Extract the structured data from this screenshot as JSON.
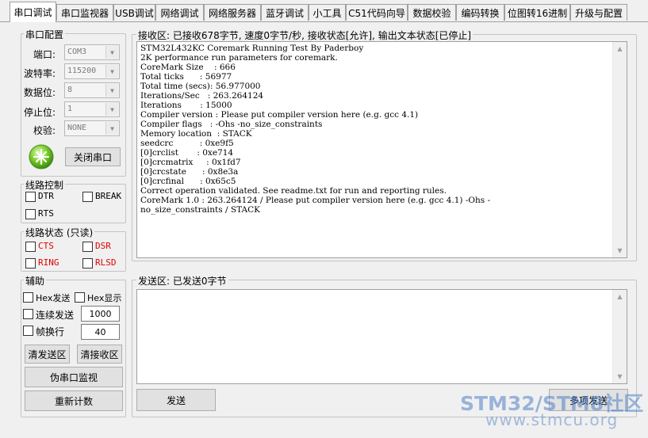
{
  "tabs": [
    "串口调试",
    "串口监视器",
    "USB调试",
    "网络调试",
    "网络服务器",
    "蓝牙调试",
    "小工具",
    "C51代码向导",
    "数据校验",
    "编码转换",
    "位图转16进制",
    "升级与配置"
  ],
  "serial_config": {
    "title": "串口配置",
    "port_label": "端口:",
    "port_value": "COM3",
    "baud_label": "波特率:",
    "baud_value": "115200",
    "databits_label": "数据位:",
    "databits_value": "8",
    "stopbits_label": "停止位:",
    "stopbits_value": "1",
    "parity_label": "校验:",
    "parity_value": "NONE",
    "close_button": "关闭串口"
  },
  "line_control": {
    "title": "线路控制",
    "dtr": "DTR",
    "break": "BREAK",
    "rts": "RTS"
  },
  "line_status": {
    "title": "线路状态 (只读)",
    "cts": "CTS",
    "dsr": "DSR",
    "ring": "RING",
    "rlsd": "RLSD"
  },
  "assist": {
    "title": "辅助",
    "hex_send": "Hex发送",
    "hex_show": "Hex显示",
    "continuous_send": "连续发送",
    "continuous_value": "1000",
    "frame_newline": "帧换行",
    "frame_value": "40",
    "clear_send": "清发送区",
    "clear_recv": "清接收区",
    "pseudo_monitor": "伪串口监视",
    "recount": "重新计数"
  },
  "receive": {
    "title": "接收区: 已接收678字节, 速度0字节/秒, 接收状态[允许], 输出文本状态[已停止]",
    "lines": [
      "STM32L432KC Coremark Running Test By Paderboy",
      "2K performance run parameters for coremark.",
      "CoreMark Size    : 666",
      "Total ticks      : 56977",
      "Total time (secs): 56.977000",
      "Iterations/Sec   : 263.264124",
      "Iterations       : 15000",
      "Compiler version : Please put compiler version here (e.g. gcc 4.1)",
      "Compiler flags   : -Ohs -no_size_constraints",
      "Memory location  : STACK",
      "seedcrc          : 0xe9f5",
      "[0]crclist       : 0xe714",
      "[0]crcmatrix     : 0x1fd7",
      "[0]crcstate      : 0x8e3a",
      "[0]crcfinal      : 0x65c5",
      "Correct operation validated. See readme.txt for run and reporting rules.",
      "CoreMark 1.0 : 263.264124 / Please put compiler version here (e.g. gcc 4.1) -Ohs -",
      "no_size_constraints / STACK"
    ]
  },
  "send": {
    "title": "发送区: 已发送0字节",
    "send_button": "发送",
    "multi_send_button": "多项发送"
  },
  "watermark": {
    "line1": "STM32/STM8社区",
    "line2": "www.stmcu.org"
  }
}
